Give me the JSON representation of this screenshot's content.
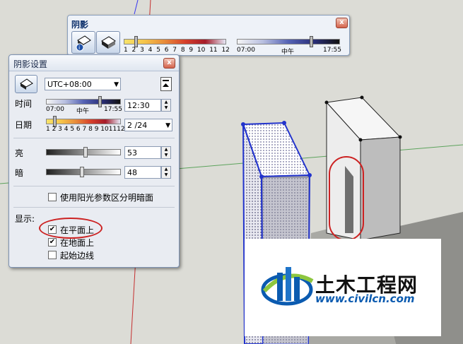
{
  "shadow_toolbar": {
    "title": "阴影",
    "close_glyph": "x",
    "date_ticks": [
      "1",
      "2",
      "3",
      "4",
      "5",
      "6",
      "7",
      "8",
      "9",
      "10",
      "11",
      "12"
    ],
    "time_start": "07:00",
    "time_mid": "中午",
    "time_end": "17:55",
    "date_level": 0.12,
    "time_level": 0.73
  },
  "shadow_dialog": {
    "title": "阴影设置",
    "close_glyph": "x",
    "timezone": "UTC+08:00",
    "time_label": "时间",
    "time_start": "07:00",
    "time_mid": "中午",
    "time_end": "17:55",
    "time_value": "12:30",
    "date_label": "日期",
    "date_ticks": "1 2 3 4 5 6 7 8 9 101112",
    "date_value": "2 /24",
    "light_label": "亮",
    "light_value": "53",
    "light_level": 0.53,
    "dark_label": "暗",
    "dark_value": "48",
    "dark_level": 0.48,
    "sun_option_label": "使用阳光参数区分明暗面",
    "sun_option_checked": false,
    "display_label": "显示:",
    "on_faces_label": "在平面上",
    "on_faces_checked": true,
    "on_ground_label": "在地面上",
    "on_ground_checked": true,
    "from_edges_label": "起始边线",
    "from_edges_checked": false,
    "time_level": 0.73,
    "date_level": 0.12
  },
  "watermark": {
    "brand": "土木工程网",
    "url": "www.civilcn.com"
  },
  "colors": {
    "background": "#dcdcd6",
    "selection_blue": "#2233cc",
    "annotation_red": "#cc2222"
  }
}
